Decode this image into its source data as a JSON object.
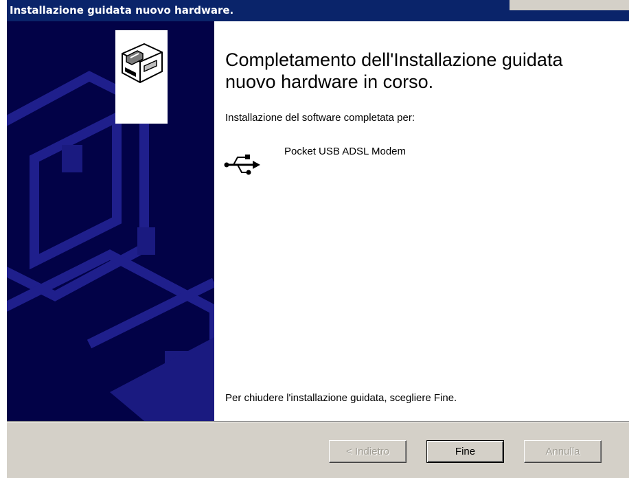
{
  "window": {
    "title": "Installazione guidata nuovo hardware."
  },
  "wizard": {
    "heading": "Completamento dell'Installazione guidata nuovo hardware in corso.",
    "subtitle": "Installazione del software completata per:",
    "device_name": "Pocket USB ADSL Modem",
    "device_icon": "usb-icon",
    "side_icon": "hardware-box-icon",
    "footer_text": "Per chiudere l'installazione guidata, scegliere Fine."
  },
  "buttons": {
    "back_label": "< Indietro",
    "finish_label": "Fine",
    "cancel_label": "Annulla",
    "back_enabled": false,
    "finish_enabled": true,
    "cancel_enabled": false
  },
  "colors": {
    "titlebar": "#0a246a",
    "side_panel": "#020247",
    "button_face": "#d4d0c8"
  }
}
